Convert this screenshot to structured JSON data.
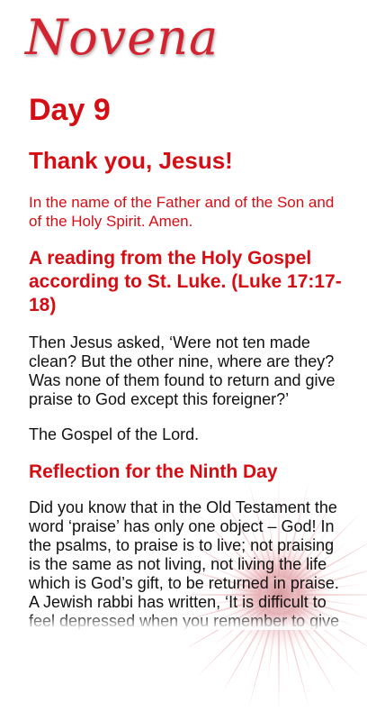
{
  "logo": {
    "text": "Novena"
  },
  "day": {
    "title": "Day 9"
  },
  "header": {
    "subtitle": "Thank you, Jesus!"
  },
  "prayer": {
    "text": "In the name of the Father and of the Son and of the Holy Spirit. Amen."
  },
  "reading": {
    "title": "A reading from the Holy Gospel according to St. Luke. (Luke 17:17-18)",
    "text": "Then Jesus asked, ‘Were not ten made clean? But the other nine, where are they? Was none of them found to return and give praise to God except this foreigner?’",
    "closing": "The Gospel of the Lord."
  },
  "reflection": {
    "title": "Reflection for the Ninth Day",
    "text": "Did you know that in the Old Testament the word ‘praise’ has only one object – God! In the psalms, to praise is to live; not praising is the same as not living, not living the life which is God’s gift, to be returned in praise. A Jewish rabbi has written, ‘It is difficult to feel depressed when you remember to give praise to the gift of"
  },
  "colors": {
    "accent": "#d40e14",
    "logo": "#d42330",
    "text": "#111111",
    "background": "#ffffff"
  },
  "icons": {
    "decoration": "sunburst-icon"
  }
}
